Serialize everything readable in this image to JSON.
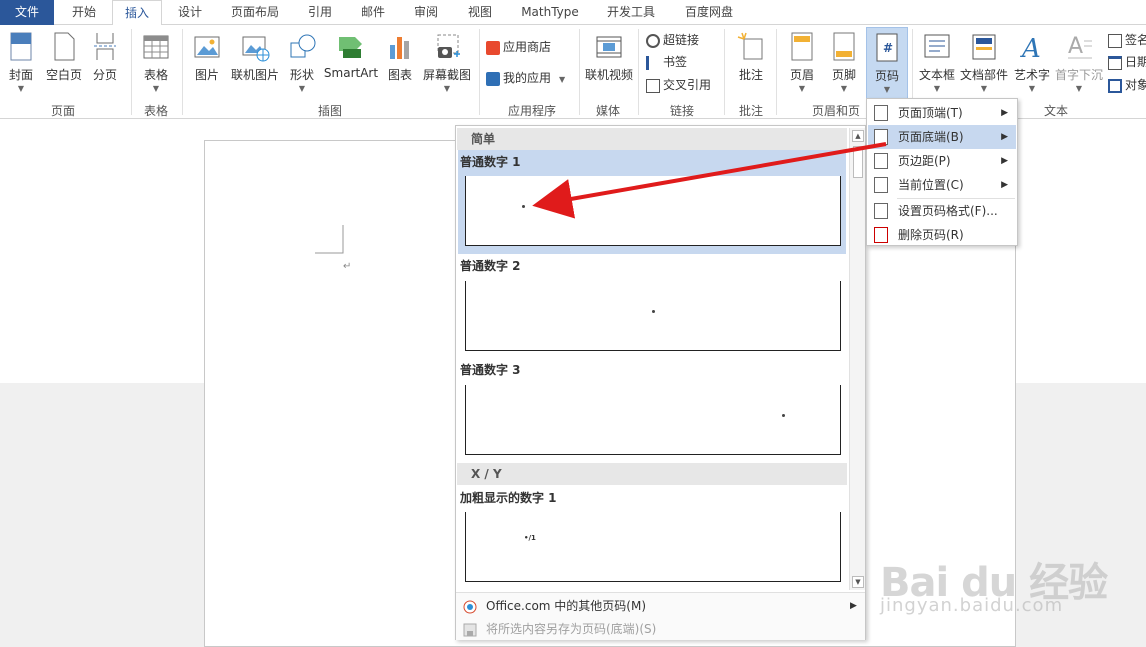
{
  "tabs": [
    {
      "label": "文件"
    },
    {
      "label": "开始"
    },
    {
      "label": "插入"
    },
    {
      "label": "设计"
    },
    {
      "label": "页面布局"
    },
    {
      "label": "引用"
    },
    {
      "label": "邮件"
    },
    {
      "label": "审阅"
    },
    {
      "label": "视图"
    },
    {
      "label": "MathType"
    },
    {
      "label": "开发工具"
    },
    {
      "label": "百度网盘"
    }
  ],
  "ribbon": {
    "buttons": {
      "cover": "封面",
      "blank_page": "空白页",
      "page_break": "分页",
      "table": "表格",
      "picture": "图片",
      "online_picture": "联机图片",
      "shapes": "形状",
      "smartart": "SmartArt",
      "chart": "图表",
      "screenshot": "屏幕截图",
      "app_store": "应用商店",
      "my_apps": "我的应用",
      "online_video": "联机视频",
      "hyperlink": "超链接",
      "bookmark": "书签",
      "cross_ref": "交叉引用",
      "comment": "批注",
      "header": "页眉",
      "footer": "页脚",
      "page_number": "页码",
      "text_box": "文本框",
      "quick_parts": "文档部件",
      "wordart": "艺术字",
      "drop_cap": "首字下沉",
      "signature": "签名",
      "date": "日期",
      "object": "对象"
    },
    "groups": {
      "pages": "页面",
      "tables": "表格",
      "illustrations": "插图",
      "apps": "应用程序",
      "media": "媒体",
      "links": "链接",
      "comments": "批注",
      "header_footer": "页眉和页",
      "text": "文本"
    }
  },
  "gallery": {
    "section_simple": "简单",
    "items": [
      {
        "title": "普通数字 1"
      },
      {
        "title": "普通数字 2"
      },
      {
        "title": "普通数字 3"
      }
    ],
    "section_xy": "X / Y",
    "item_bold": {
      "title": "加粗显示的数字 1",
      "sample": "•/1"
    },
    "more_office": "Office.com 中的其他页码(M)",
    "save_selection": "将所选内容另存为页码(底端)(S)"
  },
  "page_number_menu": {
    "items": [
      {
        "label": "页面顶端(T)"
      },
      {
        "label": "页面底端(B)"
      },
      {
        "label": "页边距(P)"
      },
      {
        "label": "当前位置(C)"
      },
      {
        "label": "设置页码格式(F)..."
      },
      {
        "label": "删除页码(R)"
      }
    ]
  },
  "watermark": {
    "main": "Bai du 经验",
    "sub": "jingyan.baidu.com"
  },
  "colors": {
    "file_tab": "#2b579a",
    "accent": "#2b579a",
    "highlight": "#c7d8ef",
    "arrow": "#e01b1b"
  }
}
